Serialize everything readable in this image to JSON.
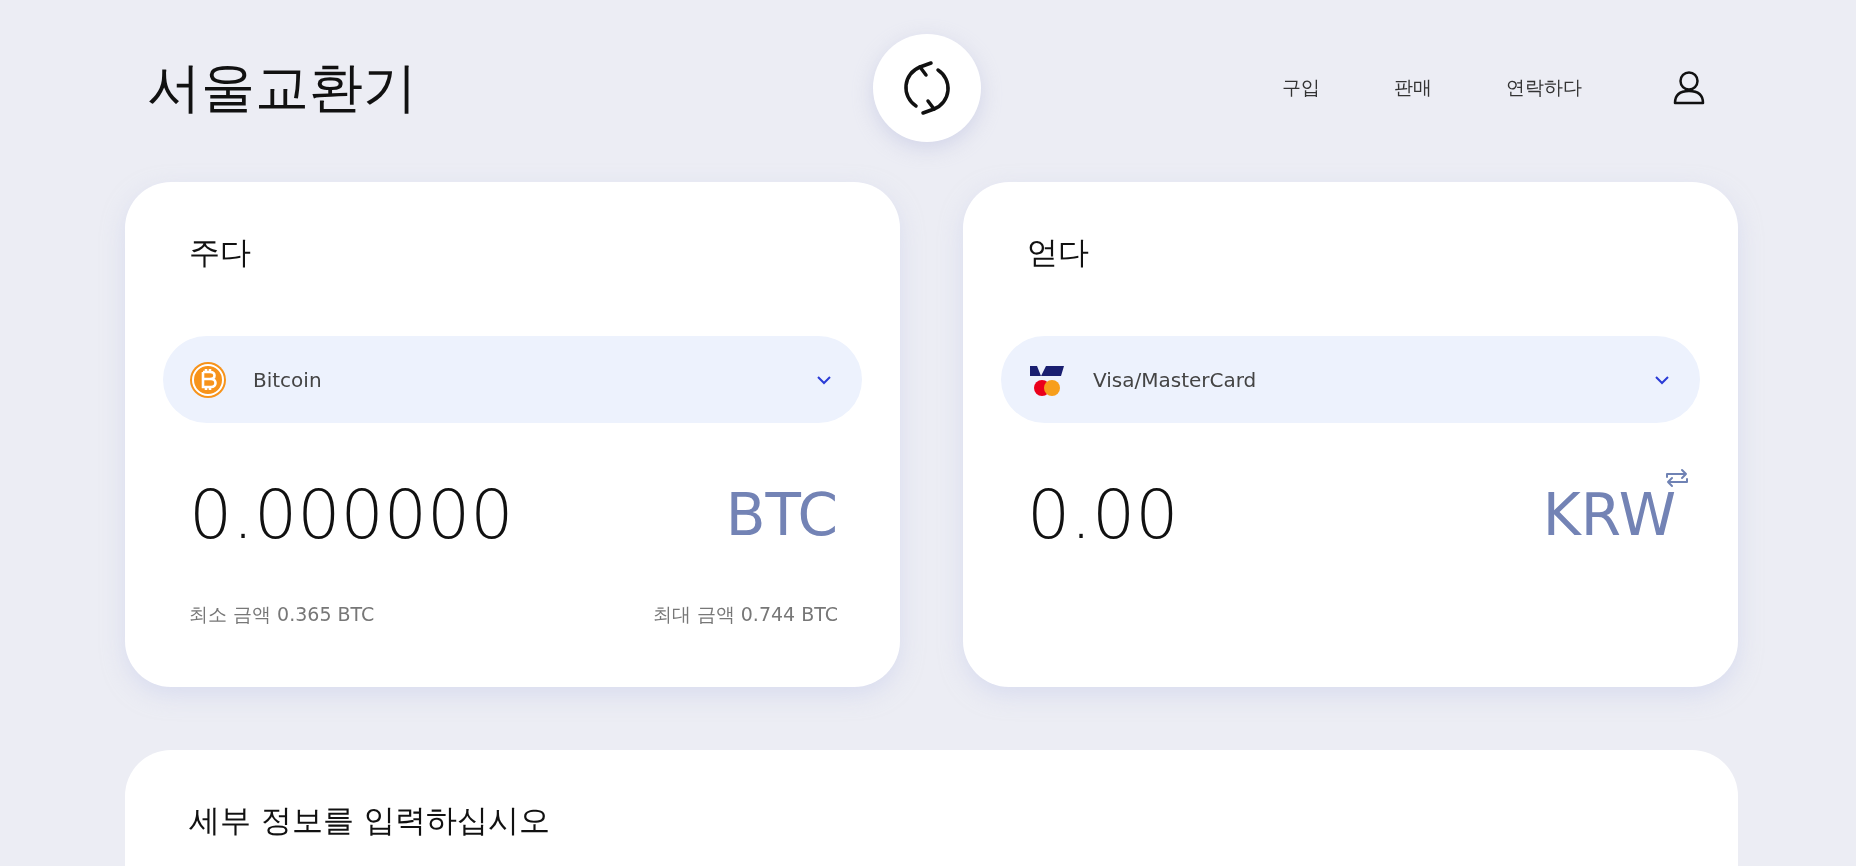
{
  "header": {
    "title": "서울교환기",
    "nav": [
      {
        "label": "구입"
      },
      {
        "label": "판매"
      },
      {
        "label": "연락하다"
      }
    ]
  },
  "cards": [
    {
      "kind": "give",
      "title": "주다",
      "currency": {
        "kind": "bitcoin",
        "name": "Bitcoin"
      },
      "amount": "0.000000",
      "unit": "BTC",
      "min": "최소 금액 0.365 BTC",
      "max": "최대 금액 0.744 BTC"
    },
    {
      "kind": "get",
      "title": "얻다",
      "currency": {
        "kind": "card",
        "name": "Visa/MasterCard"
      },
      "amount": "0.00",
      "unit": "KRW"
    }
  ],
  "details": {
    "title": "세부 정보를 입력하십시오"
  }
}
